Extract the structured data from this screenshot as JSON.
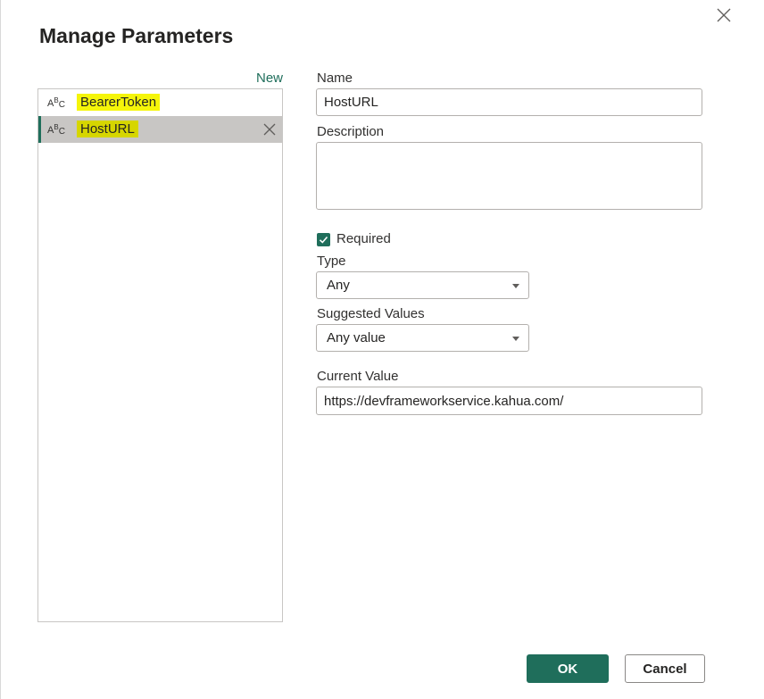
{
  "dialog": {
    "title": "Manage Parameters",
    "new_label": "New",
    "ok_label": "OK",
    "cancel_label": "Cancel"
  },
  "parameters": [
    {
      "type_icon": "text-type-icon",
      "name": "BearerToken",
      "selected": false
    },
    {
      "type_icon": "text-type-icon",
      "name": "HostURL",
      "selected": true
    }
  ],
  "form": {
    "name_label": "Name",
    "name_value": "HostURL",
    "description_label": "Description",
    "description_value": "",
    "required_label": "Required",
    "required_checked": true,
    "type_label": "Type",
    "type_value": "Any",
    "suggested_label": "Suggested Values",
    "suggested_value": "Any value",
    "current_label": "Current Value",
    "current_value": "https://devframeworkservice.kahua.com/"
  },
  "colors": {
    "accent": "#1f6e5b",
    "highlight": "#f5f50a",
    "selected_row": "#c8c6c4"
  }
}
